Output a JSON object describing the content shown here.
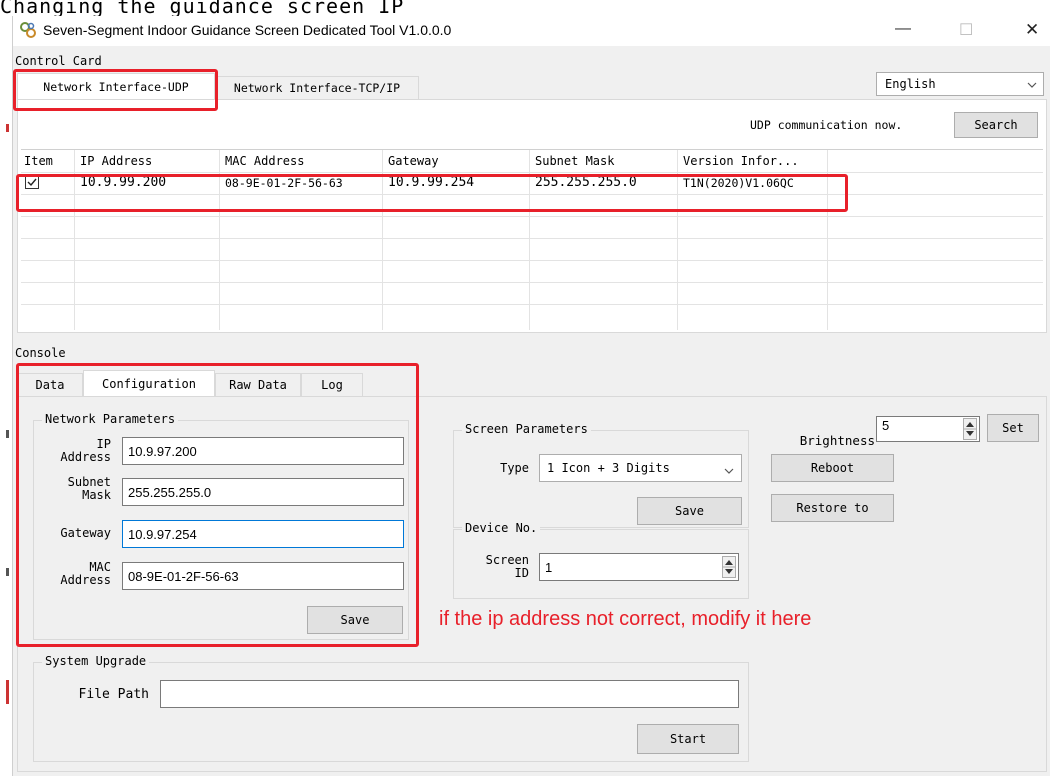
{
  "page_caption": "Changing the guidance screen IP",
  "window": {
    "title": "Seven-Segment Indoor Guidance Screen Dedicated Tool V1.0.0.0",
    "app_icon": "gear-cluster-icon",
    "minimize_glyph": "—",
    "maximize_glyph": "☐",
    "close_glyph": "✕"
  },
  "control_card": {
    "section_label": "Control Card",
    "tabs": [
      {
        "label": "Network Interface-UDP",
        "active": true
      },
      {
        "label": "Network Interface-TCP/IP",
        "active": false
      }
    ],
    "language": {
      "selected": "English"
    },
    "status_text": "UDP communication now.",
    "search_label": "Search",
    "table": {
      "columns": [
        "Item",
        "IP Address",
        "MAC Address",
        "Gateway",
        "Subnet Mask",
        "Version Infor..."
      ],
      "rows": [
        {
          "checked": true,
          "ip": "10.9.99.200",
          "mac": "08-9E-01-2F-56-63",
          "gateway": "10.9.99.254",
          "subnet": "255.255.255.0",
          "version": "T1N(2020)V1.06QC"
        }
      ]
    }
  },
  "console": {
    "section_label": "Console",
    "tabs": [
      {
        "label": "Data",
        "active": false
      },
      {
        "label": "Configuration",
        "active": true
      },
      {
        "label": "Raw Data",
        "active": false
      },
      {
        "label": "Log",
        "active": false
      }
    ],
    "network": {
      "group_label": "Network Parameters",
      "ip_label_1": "IP",
      "ip_label_2": "Address",
      "ip_value": "10.9.97.200",
      "subnet_label_1": "Subnet",
      "subnet_label_2": "Mask",
      "subnet_value": "255.255.255.0",
      "gateway_label": "Gateway",
      "gateway_value": "10.9.97.254",
      "mac_label_1": "MAC",
      "mac_label_2": "Address",
      "mac_value": "08-9E-01-2F-56-63",
      "save_label": "Save"
    },
    "screen": {
      "group_label": "Screen Parameters",
      "type_label": "Type",
      "type_value": "1 Icon + 3 Digits",
      "save_label": "Save"
    },
    "device": {
      "group_label": "Device No.",
      "screen_id_label_1": "Screen",
      "screen_id_label_2": "ID",
      "screen_id_value": "1"
    },
    "brightness": {
      "label": "Brightness",
      "value": "5",
      "set_label": "Set"
    },
    "reboot_label": "Reboot",
    "restore_label": "Restore to",
    "annotation": "if the ip address not correct, modify it here",
    "upgrade": {
      "group_label": "System Upgrade",
      "file_path_label": "File Path",
      "file_path_value": "",
      "start_label": "Start"
    }
  },
  "colors": {
    "highlight_red": "#e8202a",
    "annotation_red": "#e8202a",
    "window_bg": "#f0f0f0"
  }
}
